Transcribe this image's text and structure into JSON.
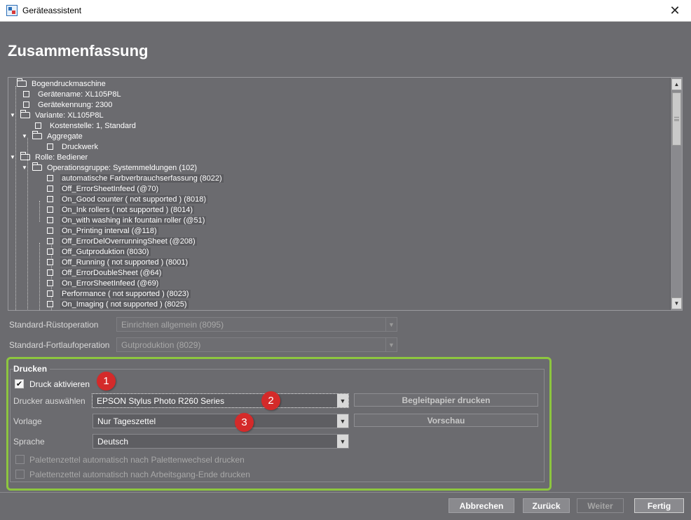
{
  "window": {
    "title": "Geräteassistent",
    "close_glyph": "✕"
  },
  "page": {
    "title": "Zusammenfassung"
  },
  "tree": {
    "rows": [
      {
        "label": "Bogendruckmaschine",
        "icon": "folder"
      },
      {
        "label": "Gerätename: XL105P8L",
        "icon": "node"
      },
      {
        "label": "Gerätekennung: 2300",
        "icon": "node"
      },
      {
        "label": "Variante: XL105P8L",
        "icon": "folder",
        "expanded": true
      },
      {
        "label": "Kostenstelle: 1, Standard",
        "icon": "node"
      },
      {
        "label": "Aggregate",
        "icon": "folder",
        "expanded": true
      },
      {
        "label": "Druckwerk",
        "icon": "node"
      },
      {
        "label": "Rolle: Bediener",
        "icon": "folder",
        "expanded": true
      },
      {
        "label": "Operationsgruppe: Systemmeldungen (102)",
        "icon": "folder",
        "expanded": true
      },
      {
        "label": "automatische Farbverbrauchserfassung (8022)",
        "icon": "node"
      },
      {
        "label": "Off_ErrorSheetInfeed (@70)",
        "icon": "node"
      },
      {
        "label": "On_Good counter ( not supported ) (8018)",
        "icon": "node"
      },
      {
        "label": "On_Ink rollers ( not supported ) (8014)",
        "icon": "node"
      },
      {
        "label": "On_with washing ink fountain roller (@51)",
        "icon": "node"
      },
      {
        "label": "On_Printing interval (@118)",
        "icon": "node"
      },
      {
        "label": "Off_ErrorDelOverrunningSheet (@208)",
        "icon": "node"
      },
      {
        "label": "Off_Gutproduktion (8030)",
        "icon": "node"
      },
      {
        "label": "Off_Running ( not supported ) (8001)",
        "icon": "node"
      },
      {
        "label": "Off_ErrorDoubleSheet (@64)",
        "icon": "node"
      },
      {
        "label": "On_ErrorSheetInfeed (@69)",
        "icon": "node"
      },
      {
        "label": "Performance ( not supported ) (8023)",
        "icon": "node"
      },
      {
        "label": "On_Imaging ( not supported ) (8025)",
        "icon": "node"
      }
    ]
  },
  "standard": {
    "setup_label": "Standard-Rüstoperation",
    "setup_value": "Einrichten allgemein (8095)",
    "continuous_label": "Standard-Fortlaufoperation",
    "continuous_value": "Gutproduktion (8029)"
  },
  "print": {
    "group_title": "Drucken",
    "enable_label": "Druck aktivieren",
    "enable_checked": true,
    "printer_label": "Drucker auswählen",
    "printer_value": "EPSON Stylus Photo R260 Series",
    "template_label": "Vorlage",
    "template_value": "Nur Tageszettel",
    "language_label": "Sprache",
    "language_value": "Deutsch",
    "print_accompanying_label": "Begleitpapier drucken",
    "preview_label": "Vorschau",
    "pallet_change_label": "Palettenzettel automatisch nach Palettenwechsel drucken",
    "operation_end_label": "Palettenzettel automatisch nach Arbeitsgang-Ende drucken"
  },
  "badges": [
    "1",
    "2",
    "3"
  ],
  "footer": {
    "cancel_label": "Abbrechen",
    "back_label": "Zurück",
    "next_label": "Weiter",
    "finish_label": "Fertig"
  },
  "colors": {
    "background": "#6b6b6f",
    "highlight": "#8dc63f",
    "badge": "#d42a2a"
  }
}
